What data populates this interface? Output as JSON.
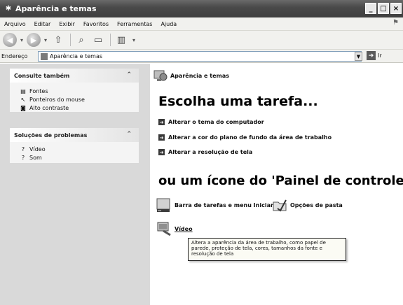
{
  "window": {
    "title": "Aparência e temas",
    "minimize": "_",
    "maximize": "□",
    "close": "×"
  },
  "menu": {
    "items": [
      "Arquivo",
      "Editar",
      "Exibir",
      "Favoritos",
      "Ferramentas",
      "Ajuda"
    ]
  },
  "address": {
    "label": "Endereço",
    "value": "Aparência e temas",
    "go_label": "Ir"
  },
  "sidebar": {
    "see_also": {
      "title": "Consulte também",
      "items": [
        "Fontes",
        "Ponteiros do mouse",
        "Alto contraste"
      ]
    },
    "troubleshoot": {
      "title": "Soluções de problemas",
      "items": [
        "Vídeo",
        "Som"
      ]
    }
  },
  "main": {
    "category": "Aparência e temas",
    "heading": "Escolha uma tarefa...",
    "tasks": [
      "Alterar o tema do computador",
      "Alterar a cor do plano de fundo da área de trabalho",
      "Alterar a resolução de tela"
    ],
    "heading2": "ou um ícone do 'Painel de controle'",
    "icons": [
      "Barra de tarefas e menu Iniciar",
      "Opções de pasta",
      "Vídeo"
    ]
  },
  "tooltip": {
    "text": "Altera a aparência da área de trabalho, como papel de parede, proteção de tela, cores, tamanhos da fonte e resolução de tela"
  }
}
